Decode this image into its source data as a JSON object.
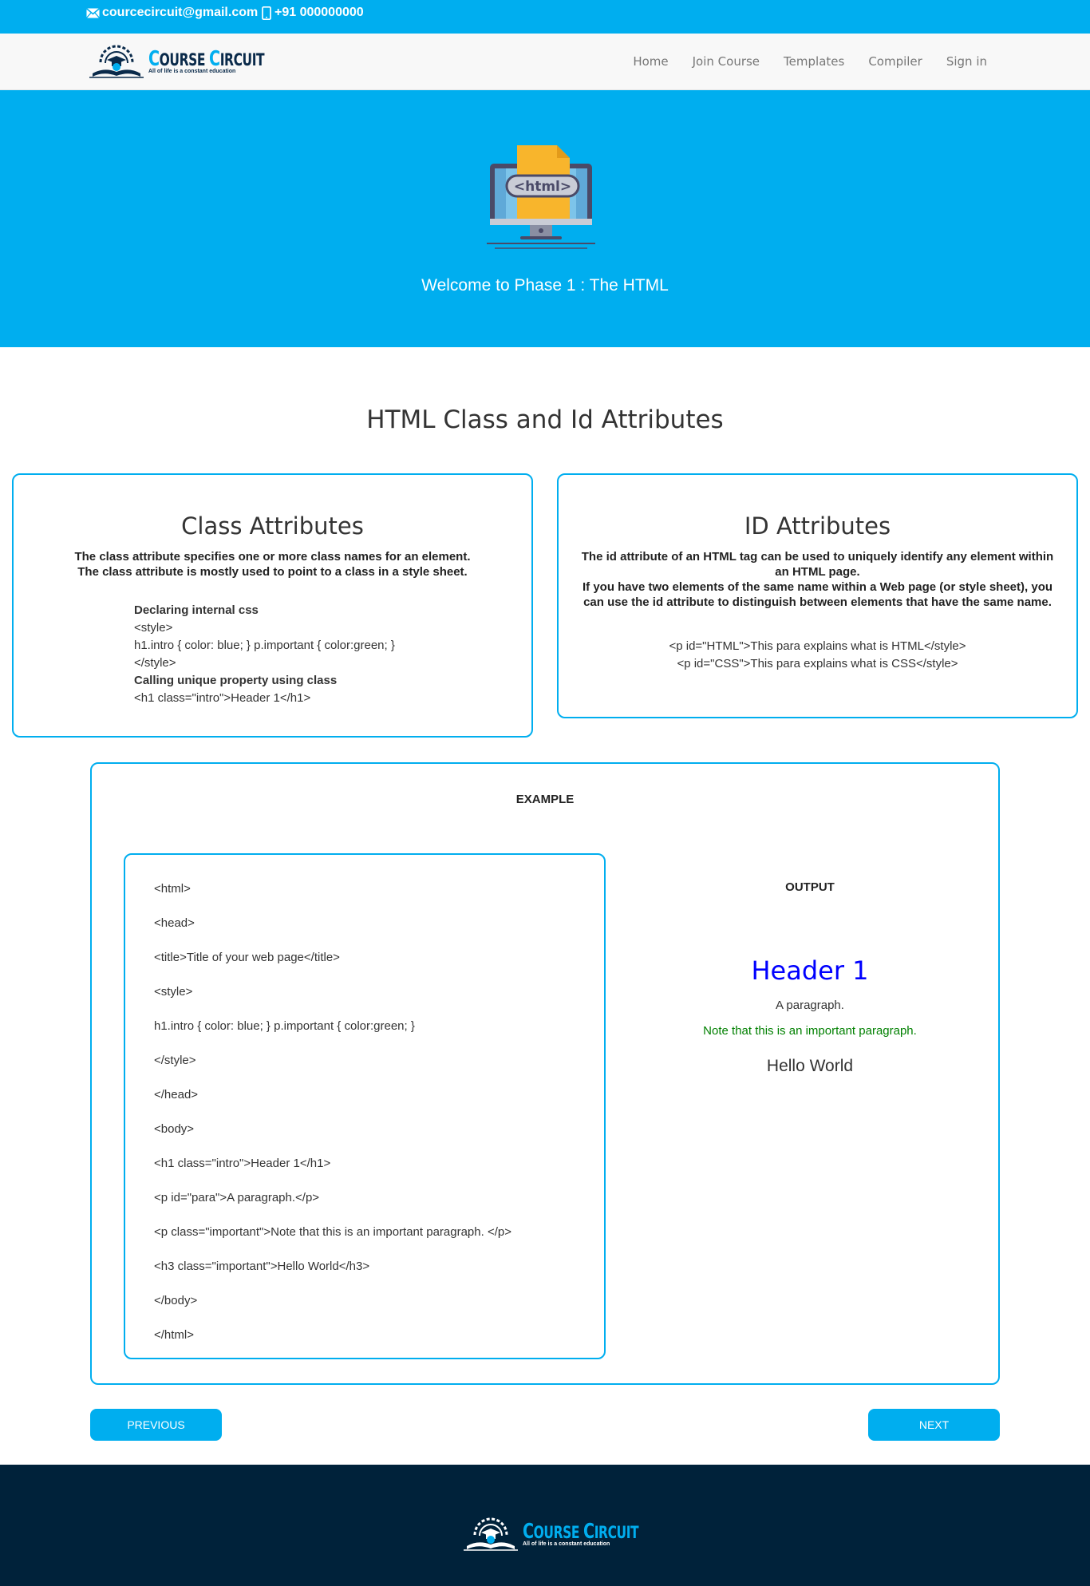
{
  "topbar": {
    "email": "courcecircuit@gmail.com",
    "phone": "+91 000000000"
  },
  "brand": {
    "title_first_letter": "C",
    "title_word1_rest": "OURSE",
    "title_word2_first": "C",
    "title_word2_rest": "IRCUIT",
    "tagline": "All of life is a constant education",
    "title_color": "#0a2a4a",
    "title_accent": "#00aeef"
  },
  "nav": {
    "items": [
      {
        "label": "Home"
      },
      {
        "label": "Join Course"
      },
      {
        "label": "Templates"
      },
      {
        "label": "Compiler"
      },
      {
        "label": "Sign in"
      }
    ]
  },
  "hero": {
    "icon_label": "<html>",
    "title": "Welcome to Phase 1 : The HTML"
  },
  "section": {
    "title": "HTML Class and Id Attributes"
  },
  "class_card": {
    "title": "Class Attributes",
    "desc_line1": "The class attribute specifies one or more class names for an element.",
    "desc_line2": "The class attribute is mostly used to point to a class in a style sheet.",
    "code": [
      {
        "text": "Declaring internal css",
        "bold": true
      },
      {
        "text": "<style>",
        "bold": false
      },
      {
        "text": "h1.intro { color: blue; } p.important { color:green; }",
        "bold": false
      },
      {
        "text": "</style>",
        "bold": false
      },
      {
        "text": "Calling unique property using class",
        "bold": true
      },
      {
        "text": "<h1 class=\"intro\">Header 1</h1>",
        "bold": false
      }
    ]
  },
  "id_card": {
    "title": "ID Attributes",
    "desc_line1": "The id attribute of an HTML tag can be used to uniquely identify any element within an HTML page.",
    "desc_line2": "If you have two elements of the same name within a Web page (or style sheet), you can use the id attribute to distinguish between elements that have the same name.",
    "code": [
      "<p id=\"HTML\">This para explains what is HTML</style>",
      "<p id=\"CSS\">This para explains what is CSS</style>"
    ]
  },
  "example": {
    "label": "EXAMPLE",
    "code_lines": [
      "<html>",
      "<head>",
      "<title>Title of your web page</title>",
      "<style>",
      "h1.intro { color: blue; } p.important { color:green; }",
      "</style>",
      "</head>",
      "<body>",
      "<h1 class=\"intro\">Header 1</h1>",
      "<p id=\"para\">A paragraph.</p>",
      "<p class=\"important\">Note that this is an important paragraph. </p>",
      "<h3 class=\"important\">Hello World</h3>",
      "</body>",
      "</html>"
    ],
    "output_label": "OUTPUT",
    "output": {
      "h1": "Header 1",
      "p": "A paragraph.",
      "important": "Note that this is an important paragraph.",
      "h3": "Hello World"
    }
  },
  "buttons": {
    "previous": "PREVIOUS",
    "next": "NEXT"
  },
  "colors": {
    "accent": "#00aeef",
    "footer_bg": "#00223a",
    "output_blue": "#0000ff",
    "output_green": "#008000"
  }
}
